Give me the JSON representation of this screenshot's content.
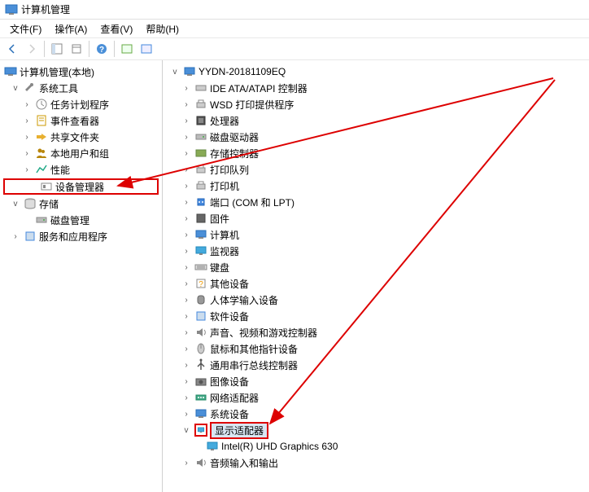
{
  "titlebar": {
    "title": "计算机管理"
  },
  "menubar": {
    "file": "文件(F)",
    "action": "操作(A)",
    "view": "查看(V)",
    "help": "帮助(H)"
  },
  "left_tree": {
    "root": "计算机管理(本地)",
    "system_tools": "系统工具",
    "task_scheduler": "任务计划程序",
    "event_viewer": "事件查看器",
    "shared_folders": "共享文件夹",
    "local_users": "本地用户和组",
    "performance": "性能",
    "device_manager": "设备管理器",
    "storage": "存储",
    "disk_mgmt": "磁盘管理",
    "services_apps": "服务和应用程序"
  },
  "right_tree": {
    "root": "YYDN-20181109EQ",
    "ide": "IDE ATA/ATAPI 控制器",
    "wsd": "WSD 打印提供程序",
    "cpu": "处理器",
    "disk_drives": "磁盘驱动器",
    "storage_ctrl": "存储控制器",
    "print_queue": "打印队列",
    "printer": "打印机",
    "ports": "端口 (COM 和 LPT)",
    "firmware": "固件",
    "computer": "计算机",
    "monitor": "监视器",
    "keyboard": "键盘",
    "other": "其他设备",
    "hid": "人体学输入设备",
    "software": "软件设备",
    "sound": "声音、视频和游戏控制器",
    "mouse": "鼠标和其他指针设备",
    "usb": "通用串行总线控制器",
    "imaging": "图像设备",
    "network": "网络适配器",
    "system_dev": "系统设备",
    "display": "显示适配器",
    "display_child": "Intel(R) UHD Graphics 630",
    "audio": "音频输入和输出"
  }
}
